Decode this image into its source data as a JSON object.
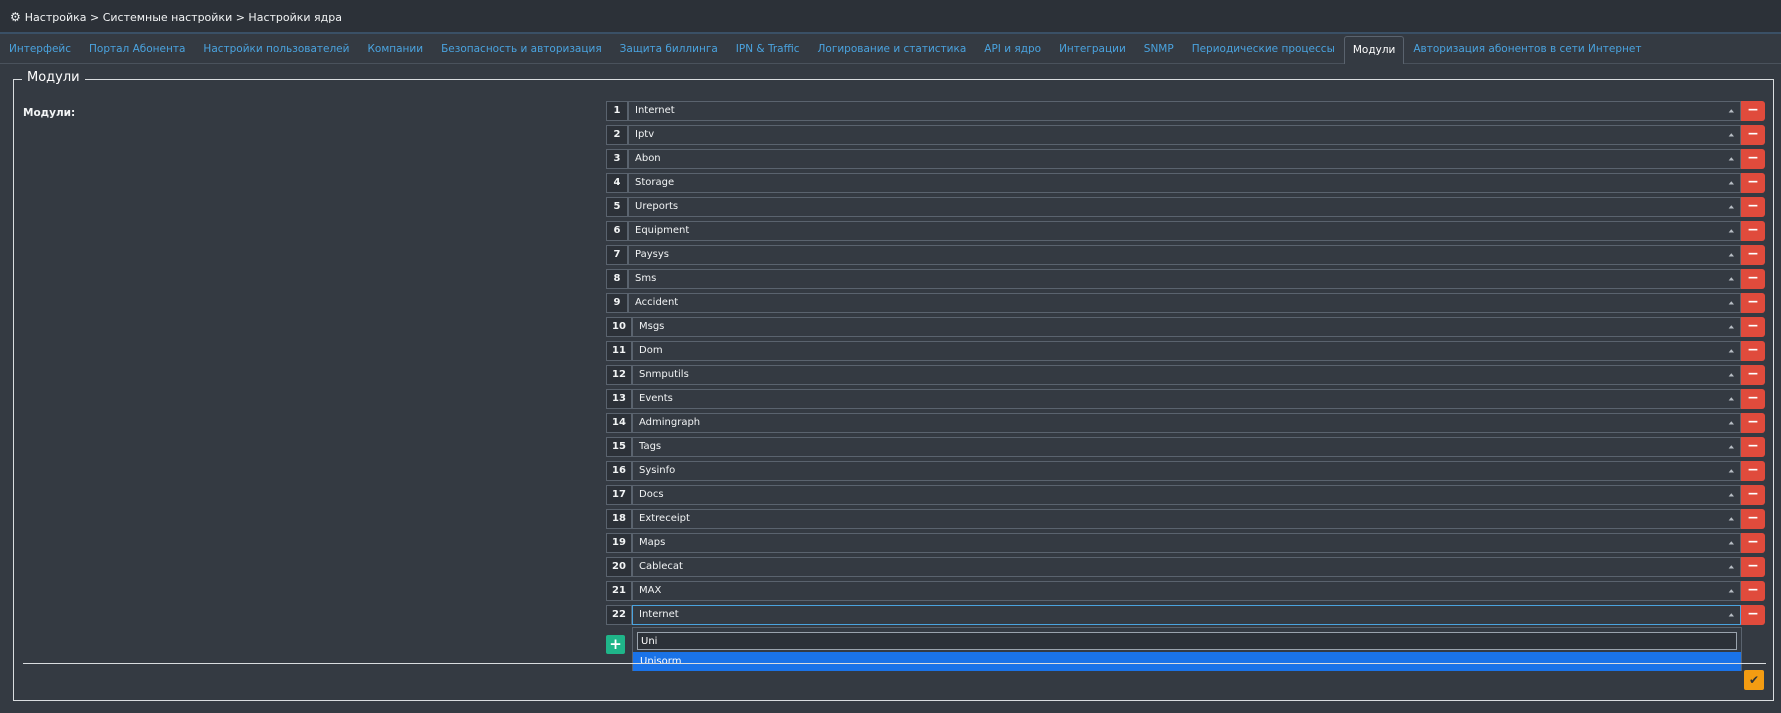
{
  "breadcrumb": "Настройка > Системные настройки > Настройки ядра",
  "tabs": [
    "Интерфейс",
    "Портал Абонента",
    "Настройки пользователей",
    "Компании",
    "Безопасность и авторизация",
    "Защита биллинга",
    "IPN & Traffic",
    "Логирование и статистика",
    "API и ядро",
    "Интеграции",
    "SNMP",
    "Периодические процессы",
    "Модули",
    "Авторизация абонентов в сети Интернет"
  ],
  "active_tab": "Модули",
  "section_title": "Модули",
  "field_label": "Модули:",
  "modules": [
    {
      "num": "1",
      "name": "Internet"
    },
    {
      "num": "2",
      "name": "Iptv"
    },
    {
      "num": "3",
      "name": "Abon"
    },
    {
      "num": "4",
      "name": "Storage"
    },
    {
      "num": "5",
      "name": "Ureports"
    },
    {
      "num": "6",
      "name": "Equipment"
    },
    {
      "num": "7",
      "name": "Paysys"
    },
    {
      "num": "8",
      "name": "Sms"
    },
    {
      "num": "9",
      "name": "Accident"
    },
    {
      "num": "10",
      "name": "Msgs"
    },
    {
      "num": "11",
      "name": "Dom"
    },
    {
      "num": "12",
      "name": "Snmputils"
    },
    {
      "num": "13",
      "name": "Events"
    },
    {
      "num": "14",
      "name": "Admingraph"
    },
    {
      "num": "15",
      "name": "Tags"
    },
    {
      "num": "16",
      "name": "Sysinfo"
    },
    {
      "num": "17",
      "name": "Docs"
    },
    {
      "num": "18",
      "name": "Extreceipt"
    },
    {
      "num": "19",
      "name": "Maps"
    },
    {
      "num": "20",
      "name": "Cablecat"
    },
    {
      "num": "21",
      "name": "MAX"
    },
    {
      "num": "22",
      "name": "Internet"
    }
  ],
  "dropdown": {
    "search_value": "Uni",
    "option": "Unisorm"
  },
  "colors": {
    "background": "#343a42",
    "link": "#4aa3df",
    "remove": "#e04b3c",
    "add": "#1fb589",
    "confirm": "#f39c12",
    "highlight": "#1a73e8"
  },
  "icons": {
    "breadcrumb": "gear-icon",
    "remove": "minus-icon",
    "add": "plus-icon",
    "confirm": "check-icon",
    "select": "chevron-down-icon"
  }
}
